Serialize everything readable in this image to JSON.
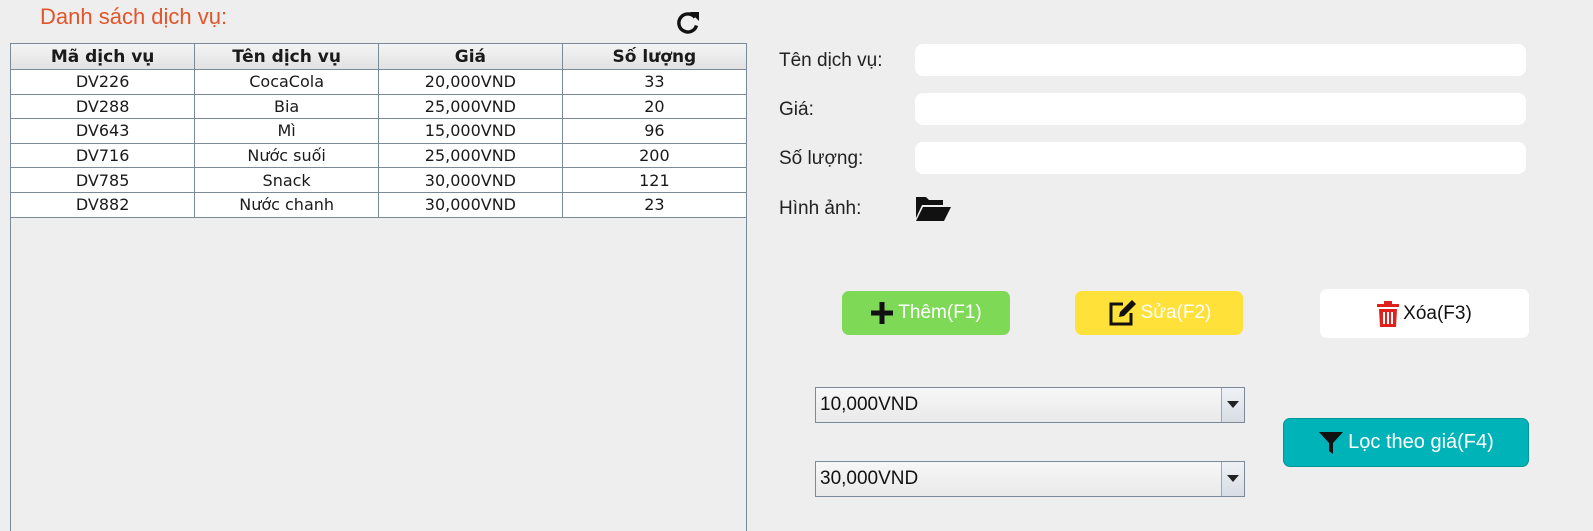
{
  "list": {
    "title": "Danh sách dịch vụ:",
    "refresh_icon": "refresh-icon"
  },
  "table": {
    "headers": [
      "Mã dịch vụ",
      "Tên dịch vụ",
      "Giá",
      "Số lượng"
    ],
    "rows": [
      [
        "DV226",
        "CocaCola",
        "20,000VND",
        "33"
      ],
      [
        "DV288",
        "Bia",
        "25,000VND",
        "20"
      ],
      [
        "DV643",
        "Mì",
        "15,000VND",
        "96"
      ],
      [
        "DV716",
        "Nước suối",
        "25,000VND",
        "200"
      ],
      [
        "DV785",
        "Snack",
        "30,000VND",
        "121"
      ],
      [
        "DV882",
        "Nước chanh",
        "30,000VND",
        "23"
      ]
    ]
  },
  "form": {
    "name_label": "Tên dịch vụ:",
    "name_value": "",
    "price_label": "Giá:",
    "price_value": "",
    "quantity_label": "Số lượng:",
    "quantity_value": "",
    "image_label": "Hình ảnh:",
    "image_icon": "folder-open-icon"
  },
  "actions": {
    "add_label": "Thêm(F1)",
    "edit_label": "Sửa(F2)",
    "delete_label": "Xóa(F3)",
    "filter_label": "Lọc theo giá(F4)"
  },
  "filter": {
    "min_price": "10,000VND",
    "max_price": "30,000VND"
  },
  "colors": {
    "title": "#e2542a",
    "add": "#7ed957",
    "edit": "#ffe13a",
    "delete_icon": "#e0201c",
    "filter": "#00b3b8"
  }
}
